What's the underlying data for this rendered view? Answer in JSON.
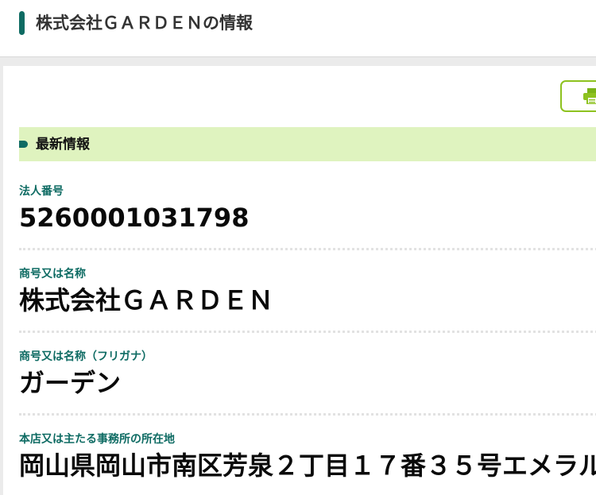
{
  "header": {
    "title": "株式会社ＧＡＲＤＥＮの情報"
  },
  "toolbar": {
    "print_icon": "printer-icon",
    "accent_color": "#8dc21f"
  },
  "section": {
    "title": "最新情報"
  },
  "fields": [
    {
      "label": "法人番号",
      "value": "5260001031798"
    },
    {
      "label": "商号又は名称",
      "value": "株式会社ＧＡＲＤＥＮ"
    },
    {
      "label": "商号又は名称（フリガナ）",
      "value": "ガーデン"
    },
    {
      "label": "本店又は主たる事務所の所在地",
      "value": "岡山県岡山市南区芳泉２丁目１７番３５号エメラル"
    }
  ],
  "colors": {
    "brand": "#0e6b63",
    "banner_bg": "#dff3bf",
    "page_bg": "#ebebeb"
  }
}
